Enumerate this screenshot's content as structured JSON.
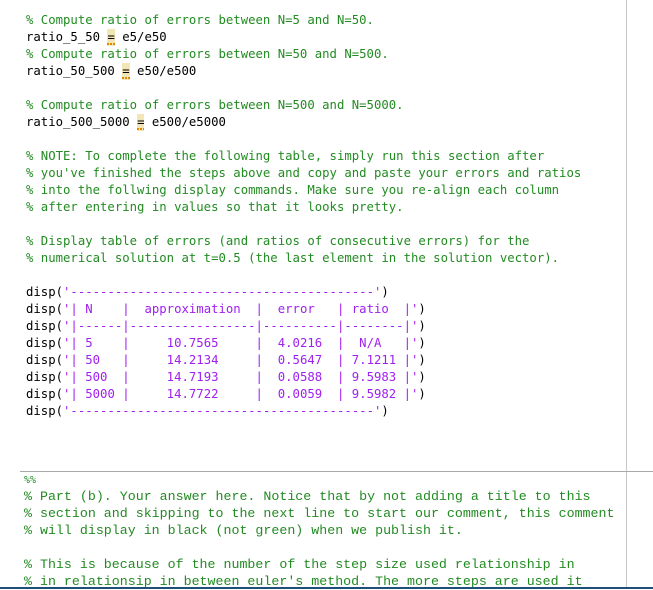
{
  "editor": {
    "lines": [
      {
        "type": "comment",
        "text": "% Compute ratio of errors between N=5 and N=50."
      },
      {
        "type": "assign",
        "lhs": "ratio_5_50 ",
        "op": "=",
        "rhs": " e5/e50"
      },
      {
        "type": "comment",
        "text": "% Compute ratio of errors between N=50 and N=500."
      },
      {
        "type": "assign",
        "lhs": "ratio_50_500 ",
        "op": "=",
        "rhs": " e50/e500"
      },
      {
        "type": "comment",
        "text": "% Compute ratio of errors between N=500 and N=5000."
      },
      {
        "type": "assign",
        "lhs": "ratio_500_5000 ",
        "op": "=",
        "rhs": " e500/e5000"
      },
      {
        "type": "comment",
        "text": "% NOTE: To complete the following table, simply run this section after"
      },
      {
        "type": "comment",
        "text": "% you've finished the steps above and copy and paste your errors and ratios"
      },
      {
        "type": "comment",
        "text": "% into the follwing display commands. Make sure you re-align each column"
      },
      {
        "type": "comment",
        "text": "% after entering in values so that it looks pretty."
      },
      {
        "type": "comment",
        "text": "% Display table of errors (and ratios of consecutive errors) for the"
      },
      {
        "type": "comment",
        "text": "% numerical solution at t=0.5 (the last element in the solution vector)."
      },
      {
        "type": "disp",
        "fn": "disp(",
        "str": "'-----------------------------------------'",
        "close": ")"
      },
      {
        "type": "disp",
        "fn": "disp(",
        "str": "'| N    |  approximation  |  error   | ratio  |'",
        "close": ")"
      },
      {
        "type": "disp",
        "fn": "disp(",
        "str": "'|------|-----------------|----------|--------|'",
        "close": ")"
      },
      {
        "type": "disp",
        "fn": "disp(",
        "str": "'| 5    |     10.7565     |  4.0216  |  N/A   |'",
        "close": ")"
      },
      {
        "type": "disp",
        "fn": "disp(",
        "str": "'| 50   |     14.2134     |  0.5647  | 7.1211 |'",
        "close": ")"
      },
      {
        "type": "disp",
        "fn": "disp(",
        "str": "'| 500  |     14.7193     |  0.0588  | 9.5983 |'",
        "close": ")"
      },
      {
        "type": "disp",
        "fn": "disp(",
        "str": "'| 5000 |     14.7722     |  0.0059  | 9.5982 |'",
        "close": ")"
      },
      {
        "type": "disp",
        "fn": "disp(",
        "str": "'-----------------------------------------'",
        "close": ")"
      },
      {
        "type": "comment",
        "text": "%%"
      },
      {
        "type": "comment",
        "text": "% Part (b). Your answer here. Notice that by not adding a title to this"
      },
      {
        "type": "comment",
        "text": "% section and skipping to the next line to start our comment, this comment"
      },
      {
        "type": "comment",
        "text": "% will display in black (not green) when we publish it."
      },
      {
        "type": "comment",
        "text": "% This is because of the number of the step size used relationship in"
      },
      {
        "type": "comment",
        "text": "% in relationsip in between euler's method. The more steps are used it"
      }
    ]
  },
  "colors": {
    "comment": "#228b22",
    "string": "#a020f0",
    "code": "#000000",
    "highlight": "#f3e6b6"
  }
}
